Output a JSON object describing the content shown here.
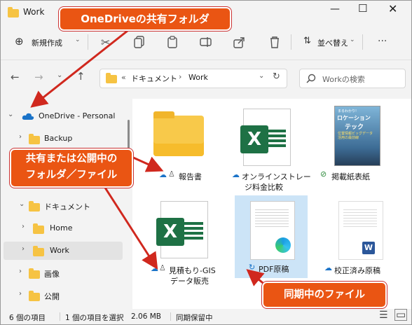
{
  "window": {
    "title": "Work"
  },
  "toolbar": {
    "new_label": "新規作成",
    "sort_label": "並べ替え"
  },
  "address": {
    "crumb_prefix": "«",
    "crumb1": "ドキュメント",
    "sep": "›",
    "crumb2": "Work"
  },
  "search": {
    "placeholder": "Workの検索"
  },
  "nav": {
    "onedrive": "OneDrive - Personal",
    "backup": "Backup",
    "documents": "ドキュメント",
    "home": "Home",
    "work": "Work",
    "pictures": "画像",
    "public": "公開"
  },
  "files": {
    "f1": "報告書",
    "f2_line1": "オンラインストレー",
    "f2_line2": "ジ料金比較",
    "f3": "掲載紙表紙",
    "f4_line1": "見積もり-GIS",
    "f4_line2": "データ販売",
    "f5": "PDF原稿",
    "f6": "校正済み原稿"
  },
  "magazine": {
    "small": "まるわかり!",
    "title1": "ロケーション",
    "title2": "テック",
    "sub": "位置情報ビッグデータ 活用の最前線"
  },
  "status": {
    "count": "6 個の項目",
    "selected": "1 個の項目を選択",
    "size": "2.06 MB",
    "sync": "同期保留中"
  },
  "callouts": {
    "c1": "OneDriveの共有フォルダ",
    "c2_line1": "共有または公開中の",
    "c2_line2": "フォルダ／ファイル",
    "c3": "同期中のファイル"
  },
  "colors": {
    "callout": "#ea5513",
    "excel": "#1e7145",
    "folder": "#f6c343",
    "accent": "#0078d4"
  }
}
